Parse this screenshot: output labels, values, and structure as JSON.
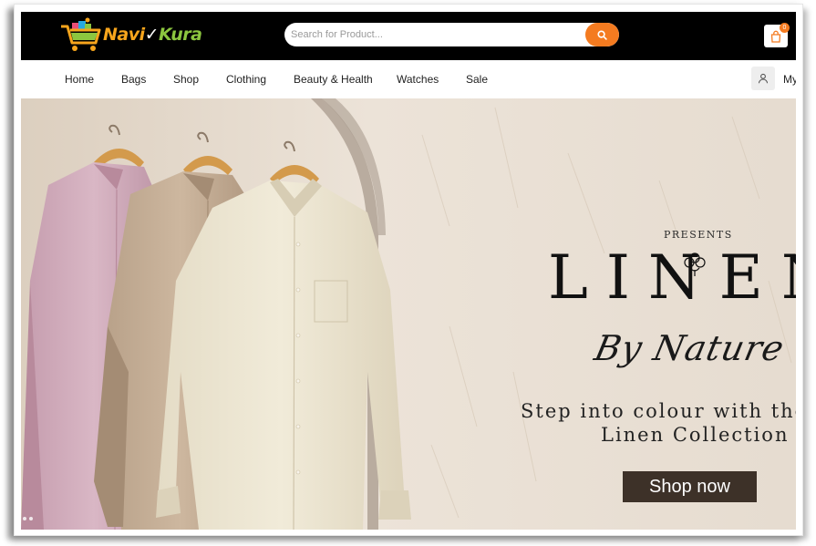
{
  "header": {
    "logo": {
      "part1": "Navi",
      "part2": "✓",
      "part3": "Kura",
      "icon": "shopping-cart-logo-icon"
    },
    "search": {
      "placeholder": "Search for Product...",
      "value": "",
      "button_icon": "search-icon"
    },
    "cart": {
      "icon": "shopping-bag-icon",
      "count": "0"
    }
  },
  "nav": {
    "items": [
      {
        "label": "Home"
      },
      {
        "label": "Bags"
      },
      {
        "label": "Shop"
      },
      {
        "label": "Clothing"
      },
      {
        "label": "Beauty & Health"
      },
      {
        "label": "Watches"
      },
      {
        "label": "Sale"
      }
    ],
    "account": {
      "icon": "user-icon",
      "label": "My"
    }
  },
  "hero": {
    "presents": "PRESENTS",
    "title": "LINEN",
    "script": "By Nature",
    "tagline_line1": "Step into colour with the",
    "tagline_line2": "Linen Collection",
    "cta": "Shop now"
  },
  "colors": {
    "topbar": "#000000",
    "accent": "#f47b20",
    "hero_bg": "#e8ddd0",
    "cta_bg": "#3d3128"
  }
}
